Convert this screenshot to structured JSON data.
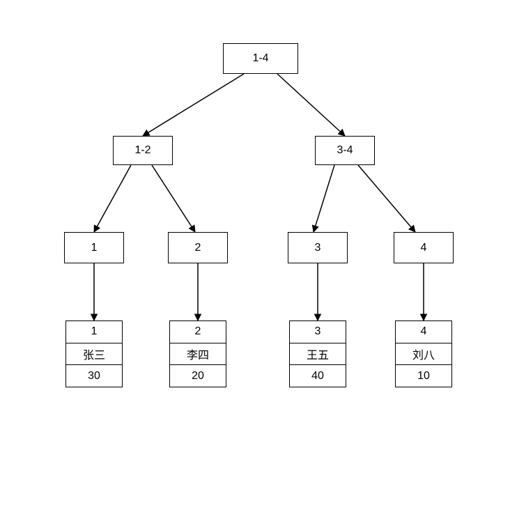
{
  "tree": {
    "root": {
      "label": "1-4"
    },
    "level2": {
      "left": {
        "label": "1-2"
      },
      "right": {
        "label": "3-4"
      }
    },
    "level3": {
      "n1": {
        "label": "1"
      },
      "n2": {
        "label": "2"
      },
      "n3": {
        "label": "3"
      },
      "n4": {
        "label": "4"
      }
    },
    "records": {
      "r1": {
        "id": "1",
        "name": "张三",
        "value": "30"
      },
      "r2": {
        "id": "2",
        "name": "李四",
        "value": "20"
      },
      "r3": {
        "id": "3",
        "name": "王五",
        "value": "40"
      },
      "r4": {
        "id": "4",
        "name": "刘八",
        "value": "10"
      }
    }
  }
}
